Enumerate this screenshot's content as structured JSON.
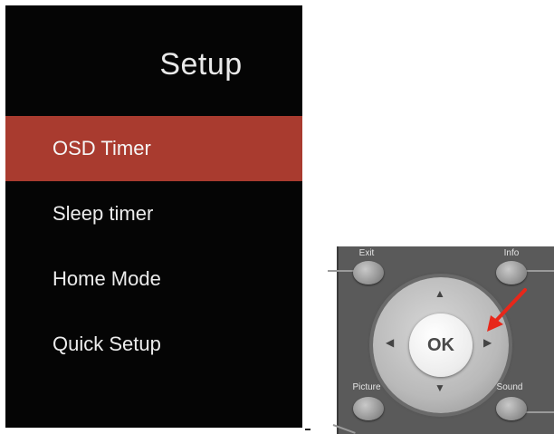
{
  "menu": {
    "title": "Setup",
    "items": [
      {
        "label": "OSD Timer",
        "selected": true
      },
      {
        "label": "Sleep timer",
        "selected": false
      },
      {
        "label": "Home Mode",
        "selected": false
      },
      {
        "label": "Quick Setup",
        "selected": false
      }
    ],
    "highlight_color": "#a93b2f"
  },
  "remote": {
    "exit_label": "Exit",
    "info_label": "Info",
    "picture_label": "Picture",
    "sound_label": "Sound",
    "ok_label": "OK",
    "pointer_color": "#e8271a"
  }
}
